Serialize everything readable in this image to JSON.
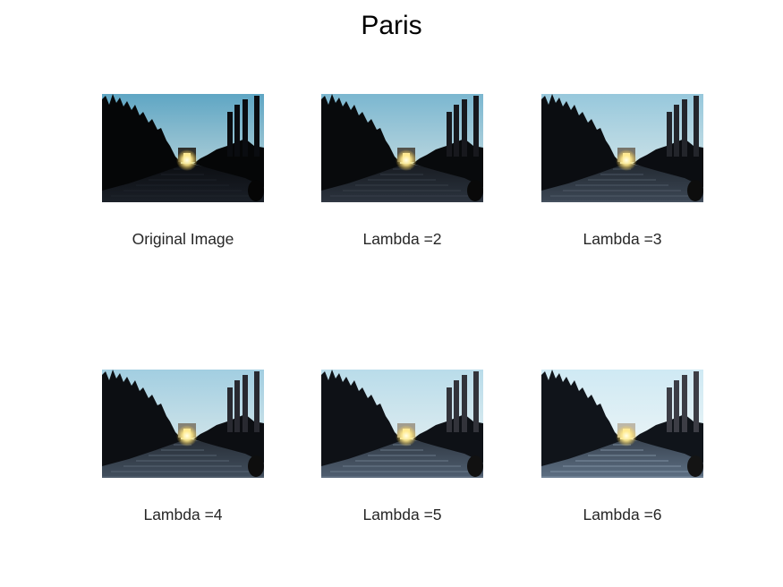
{
  "figure": {
    "title": "Paris"
  },
  "panels": [
    {
      "caption": "Original Image",
      "brightness": 0.0
    },
    {
      "caption": "Lambda =2",
      "brightness": 0.25
    },
    {
      "caption": "Lambda =3",
      "brightness": 0.5
    },
    {
      "caption": "Lambda =4",
      "brightness": 0.6
    },
    {
      "caption": "Lambda =5",
      "brightness": 0.8
    },
    {
      "caption": "Lambda =6",
      "brightness": 1.0
    }
  ]
}
